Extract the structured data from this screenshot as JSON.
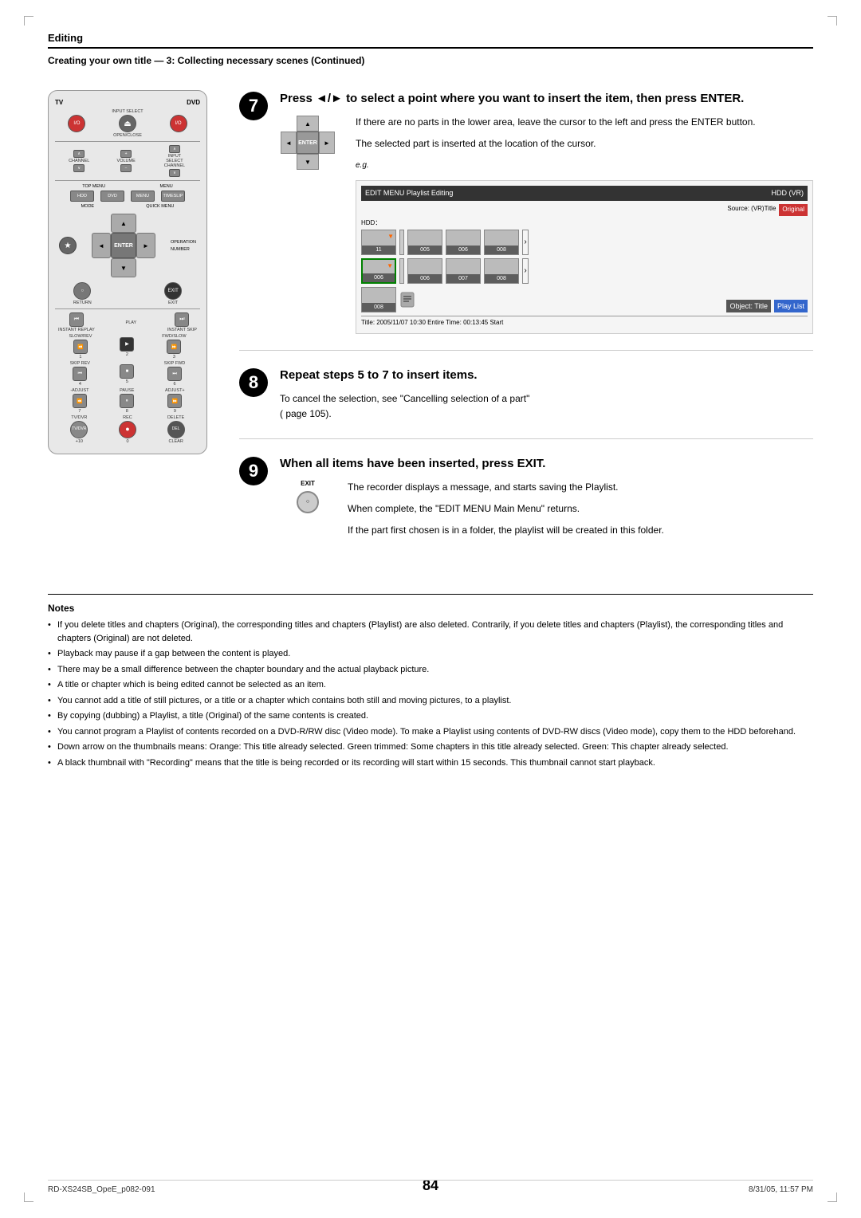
{
  "page": {
    "number": "84",
    "footer_left": "RD-XS24SB_OpeE_p082-091",
    "footer_center": "84",
    "footer_right": "8/31/05, 11:57 PM"
  },
  "header": {
    "section": "Editing",
    "subtitle": "Creating your own title — 3: Collecting necessary scenes (Continued)"
  },
  "step7": {
    "number": "7",
    "title": "Press ◄/► to select a point where you want to insert the item, then press ENTER.",
    "text1": "If there are no parts in the lower area, leave the cursor to the left and press the ENTER button.",
    "text2": "The selected part is inserted at the location of the cursor.",
    "eg_label": "e.g.",
    "screenshot": {
      "header_left": "EDIT MENU  Playlist Editing",
      "header_right": "HDD (VR)",
      "source_label": "Source: (VR)Title",
      "source_value": "Original",
      "hdd_label": "HDD：",
      "thumbs": [
        {
          "num": "11",
          "arrow": true
        },
        {
          "num": "005"
        },
        {
          "num": "006"
        },
        {
          "num": "008"
        },
        {
          "num": "006",
          "arrow": true
        },
        {
          "num": "006"
        },
        {
          "num": "007"
        },
        {
          "num": "008"
        }
      ],
      "object_row": "008",
      "object_title": "Object: Title",
      "playlist_label": "Play List",
      "footer": "Title: 2005/11/07  10:30     Entire Time:  00:13:45     Start"
    }
  },
  "step8": {
    "number": "8",
    "title": "Repeat steps 5 to 7 to insert items.",
    "text1": "To cancel the selection, see \"Cancelling selection of a part\"",
    "text2": "( page 105)."
  },
  "step9": {
    "number": "9",
    "title": "When all items have been inserted, press EXIT.",
    "text1": "The recorder displays a message, and starts saving the Playlist.",
    "text2": "When complete, the \"EDIT MENU Main Menu\" returns.",
    "text3": "If the part first chosen is in a folder, the playlist will be created in this folder."
  },
  "notes": {
    "title": "Notes",
    "items": [
      "If you delete titles and chapters (Original), the corresponding titles and chapters (Playlist) are also deleted. Contrarily, if you delete titles and chapters (Playlist), the corresponding titles and chapters (Original) are not deleted.",
      "Playback may pause if a gap between the content is played.",
      "There may be a small difference between the chapter boundary and the actual playback picture.",
      "A title or chapter which is being edited cannot be selected as an item.",
      "You cannot add a title of still pictures, or a title or a chapter which contains both still and moving pictures, to a playlist.",
      "By copying (dubbing) a Playlist, a title (Original) of the same contents is created.",
      "You cannot program a Playlist of contents recorded on a DVD-R/RW disc (Video mode). To make a Playlist using contents of DVD-RW discs (Video mode), copy them to the HDD beforehand.",
      "Down arrow on the thumbnails means: Orange: This title already selected. Green trimmed: Some chapters in this title already selected. Green: This chapter already selected.",
      "A black thumbnail with \"Recording\" means that the title is being recorded or its recording will start within 15 seconds. This thumbnail cannot start playback."
    ]
  },
  "remote": {
    "tv_label": "TV",
    "dvd_label": "DVD",
    "input_select": "INPUT SELECT",
    "open_close": "OPEN/CLOSE",
    "channel": "CHANNEL",
    "volume": "VOLUME",
    "input_select_ch": "INPUT SELECT CHANNEL",
    "top_menu": "TOP MENU",
    "menu": "MENU",
    "hdd": "HDD",
    "dvd_btn": "DVD",
    "menu_btn": "MENU",
    "timeslip": "TIMESLIP",
    "mode": "MODE",
    "quick_menu": "QUICK MENU",
    "operation": "OPERATION",
    "number": "NUMBER",
    "enter": "ENTER",
    "return": "RETURN",
    "exit": "EXIT",
    "instant_replay": "INSTANT REPLAY",
    "instant_skip": "INSTANT SKIP",
    "play": "PLAY",
    "slow_rev": "SLOW/REV",
    "fwd_slow": "FWD/SLOW",
    "stop": "STOP",
    "skip_rev": "SKIP REV",
    "skip_fwd": "SKIP FWD",
    "pause": "PAUSE",
    "adjust_minus": "-ADJUST",
    "adjust_plus": "ADJUST+",
    "tv_dvr": "TV/DVR",
    "rec": "REC",
    "delete": "DELETE",
    "clear": "CLEAR"
  }
}
